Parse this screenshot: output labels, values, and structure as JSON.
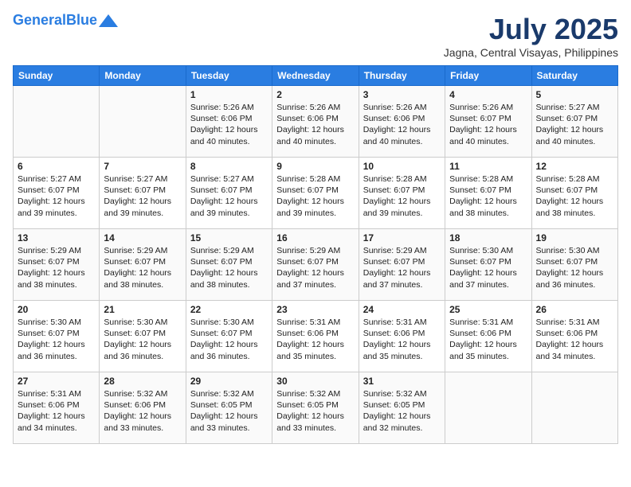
{
  "header": {
    "logo_line1": "General",
    "logo_line2": "Blue",
    "month_year": "July 2025",
    "location": "Jagna, Central Visayas, Philippines"
  },
  "days_of_week": [
    "Sunday",
    "Monday",
    "Tuesday",
    "Wednesday",
    "Thursday",
    "Friday",
    "Saturday"
  ],
  "weeks": [
    [
      {
        "day": null
      },
      {
        "day": null
      },
      {
        "day": "1",
        "sunrise": "Sunrise: 5:26 AM",
        "sunset": "Sunset: 6:06 PM",
        "daylight": "Daylight: 12 hours and 40 minutes."
      },
      {
        "day": "2",
        "sunrise": "Sunrise: 5:26 AM",
        "sunset": "Sunset: 6:06 PM",
        "daylight": "Daylight: 12 hours and 40 minutes."
      },
      {
        "day": "3",
        "sunrise": "Sunrise: 5:26 AM",
        "sunset": "Sunset: 6:06 PM",
        "daylight": "Daylight: 12 hours and 40 minutes."
      },
      {
        "day": "4",
        "sunrise": "Sunrise: 5:26 AM",
        "sunset": "Sunset: 6:07 PM",
        "daylight": "Daylight: 12 hours and 40 minutes."
      },
      {
        "day": "5",
        "sunrise": "Sunrise: 5:27 AM",
        "sunset": "Sunset: 6:07 PM",
        "daylight": "Daylight: 12 hours and 40 minutes."
      }
    ],
    [
      {
        "day": "6",
        "sunrise": "Sunrise: 5:27 AM",
        "sunset": "Sunset: 6:07 PM",
        "daylight": "Daylight: 12 hours and 39 minutes."
      },
      {
        "day": "7",
        "sunrise": "Sunrise: 5:27 AM",
        "sunset": "Sunset: 6:07 PM",
        "daylight": "Daylight: 12 hours and 39 minutes."
      },
      {
        "day": "8",
        "sunrise": "Sunrise: 5:27 AM",
        "sunset": "Sunset: 6:07 PM",
        "daylight": "Daylight: 12 hours and 39 minutes."
      },
      {
        "day": "9",
        "sunrise": "Sunrise: 5:28 AM",
        "sunset": "Sunset: 6:07 PM",
        "daylight": "Daylight: 12 hours and 39 minutes."
      },
      {
        "day": "10",
        "sunrise": "Sunrise: 5:28 AM",
        "sunset": "Sunset: 6:07 PM",
        "daylight": "Daylight: 12 hours and 39 minutes."
      },
      {
        "day": "11",
        "sunrise": "Sunrise: 5:28 AM",
        "sunset": "Sunset: 6:07 PM",
        "daylight": "Daylight: 12 hours and 38 minutes."
      },
      {
        "day": "12",
        "sunrise": "Sunrise: 5:28 AM",
        "sunset": "Sunset: 6:07 PM",
        "daylight": "Daylight: 12 hours and 38 minutes."
      }
    ],
    [
      {
        "day": "13",
        "sunrise": "Sunrise: 5:29 AM",
        "sunset": "Sunset: 6:07 PM",
        "daylight": "Daylight: 12 hours and 38 minutes."
      },
      {
        "day": "14",
        "sunrise": "Sunrise: 5:29 AM",
        "sunset": "Sunset: 6:07 PM",
        "daylight": "Daylight: 12 hours and 38 minutes."
      },
      {
        "day": "15",
        "sunrise": "Sunrise: 5:29 AM",
        "sunset": "Sunset: 6:07 PM",
        "daylight": "Daylight: 12 hours and 38 minutes."
      },
      {
        "day": "16",
        "sunrise": "Sunrise: 5:29 AM",
        "sunset": "Sunset: 6:07 PM",
        "daylight": "Daylight: 12 hours and 37 minutes."
      },
      {
        "day": "17",
        "sunrise": "Sunrise: 5:29 AM",
        "sunset": "Sunset: 6:07 PM",
        "daylight": "Daylight: 12 hours and 37 minutes."
      },
      {
        "day": "18",
        "sunrise": "Sunrise: 5:30 AM",
        "sunset": "Sunset: 6:07 PM",
        "daylight": "Daylight: 12 hours and 37 minutes."
      },
      {
        "day": "19",
        "sunrise": "Sunrise: 5:30 AM",
        "sunset": "Sunset: 6:07 PM",
        "daylight": "Daylight: 12 hours and 36 minutes."
      }
    ],
    [
      {
        "day": "20",
        "sunrise": "Sunrise: 5:30 AM",
        "sunset": "Sunset: 6:07 PM",
        "daylight": "Daylight: 12 hours and 36 minutes."
      },
      {
        "day": "21",
        "sunrise": "Sunrise: 5:30 AM",
        "sunset": "Sunset: 6:07 PM",
        "daylight": "Daylight: 12 hours and 36 minutes."
      },
      {
        "day": "22",
        "sunrise": "Sunrise: 5:30 AM",
        "sunset": "Sunset: 6:07 PM",
        "daylight": "Daylight: 12 hours and 36 minutes."
      },
      {
        "day": "23",
        "sunrise": "Sunrise: 5:31 AM",
        "sunset": "Sunset: 6:06 PM",
        "daylight": "Daylight: 12 hours and 35 minutes."
      },
      {
        "day": "24",
        "sunrise": "Sunrise: 5:31 AM",
        "sunset": "Sunset: 6:06 PM",
        "daylight": "Daylight: 12 hours and 35 minutes."
      },
      {
        "day": "25",
        "sunrise": "Sunrise: 5:31 AM",
        "sunset": "Sunset: 6:06 PM",
        "daylight": "Daylight: 12 hours and 35 minutes."
      },
      {
        "day": "26",
        "sunrise": "Sunrise: 5:31 AM",
        "sunset": "Sunset: 6:06 PM",
        "daylight": "Daylight: 12 hours and 34 minutes."
      }
    ],
    [
      {
        "day": "27",
        "sunrise": "Sunrise: 5:31 AM",
        "sunset": "Sunset: 6:06 PM",
        "daylight": "Daylight: 12 hours and 34 minutes."
      },
      {
        "day": "28",
        "sunrise": "Sunrise: 5:32 AM",
        "sunset": "Sunset: 6:06 PM",
        "daylight": "Daylight: 12 hours and 33 minutes."
      },
      {
        "day": "29",
        "sunrise": "Sunrise: 5:32 AM",
        "sunset": "Sunset: 6:05 PM",
        "daylight": "Daylight: 12 hours and 33 minutes."
      },
      {
        "day": "30",
        "sunrise": "Sunrise: 5:32 AM",
        "sunset": "Sunset: 6:05 PM",
        "daylight": "Daylight: 12 hours and 33 minutes."
      },
      {
        "day": "31",
        "sunrise": "Sunrise: 5:32 AM",
        "sunset": "Sunset: 6:05 PM",
        "daylight": "Daylight: 12 hours and 32 minutes."
      },
      {
        "day": null
      },
      {
        "day": null
      }
    ]
  ]
}
